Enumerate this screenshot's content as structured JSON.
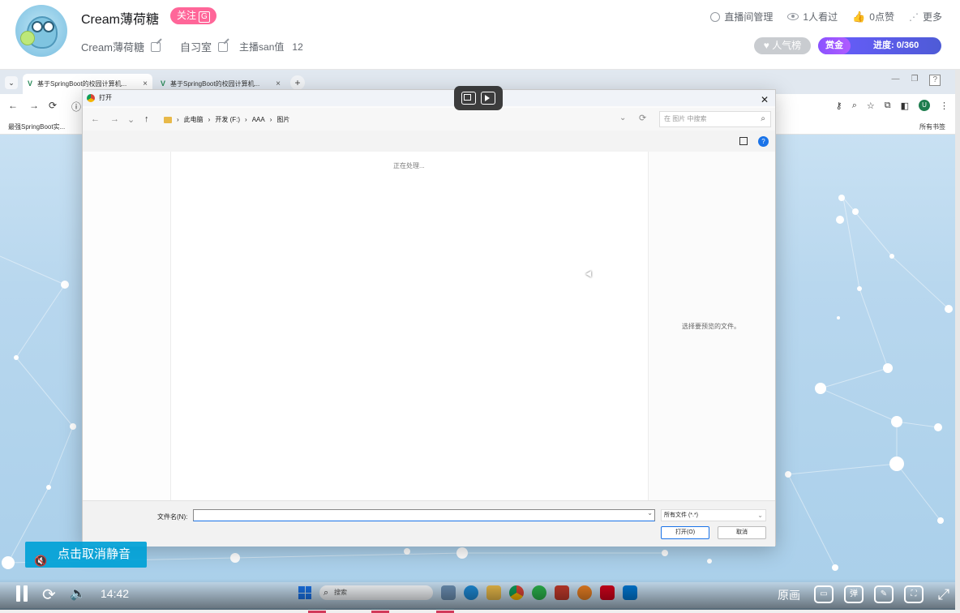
{
  "header": {
    "streamer_name": "Cream薄荷糖",
    "follow_label": "关注",
    "follow_tag": "G",
    "sub_name": "Cream薄荷糖",
    "room_title": "自习室",
    "san_label": "主播san值",
    "san_value": "12",
    "actions": [
      {
        "label": "直播间管理"
      },
      {
        "label": "1人看过"
      },
      {
        "label": "0点赞"
      },
      {
        "label": "更多"
      }
    ],
    "rank_label": "人气榜",
    "reward_label": "赏金",
    "progress_label": "进度: 0/360"
  },
  "browser": {
    "tabs": [
      {
        "title": "基于SpringBoot的校园计算机..."
      },
      {
        "title": "基于SpringBoot的校园计算机..."
      }
    ],
    "bookmark_left": "最强SpringBoot实...",
    "bookmark_right": "所有书签",
    "user_initial": "U"
  },
  "dialog": {
    "title": "打开",
    "path": [
      "此电脑",
      "开发 (F:)",
      "AAA",
      "图片"
    ],
    "search_placeholder": "在 图片 中搜索",
    "processing_text": "正在处理...",
    "preview_text": "选择要预览的文件。",
    "filename_label": "文件名(N):",
    "filename_value": "",
    "filetype_value": "所有文件 (*.*)",
    "open_label": "打开(O)",
    "cancel_label": "取消"
  },
  "player": {
    "mute_tip": "点击取消静音",
    "time": "14:42",
    "quality": "原画",
    "danmaku_label": "弹"
  },
  "taskbar": {
    "search_placeholder": "搜索"
  }
}
